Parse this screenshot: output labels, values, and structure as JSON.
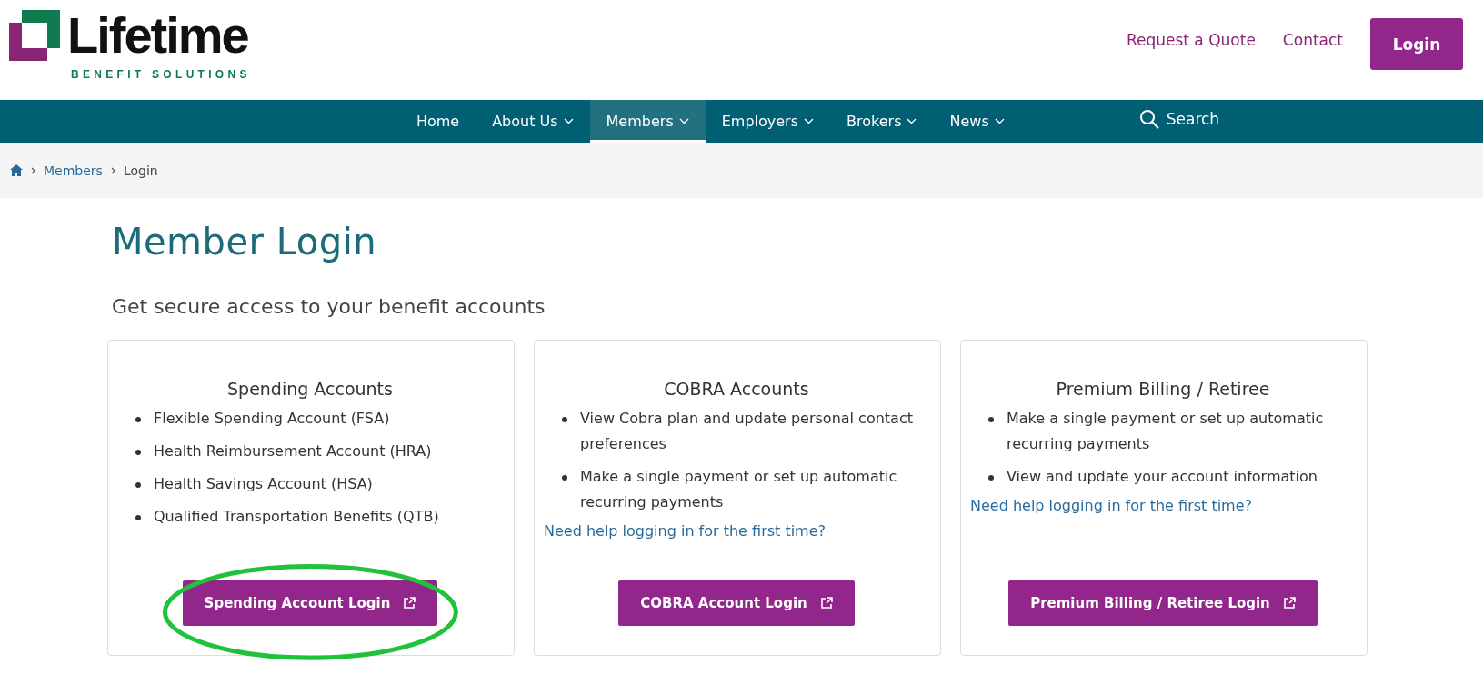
{
  "logo": {
    "name": "Lifetime",
    "tagline": "BENEFIT SOLUTIONS"
  },
  "header_links": [
    {
      "label": "Request a Quote"
    },
    {
      "label": "Contact"
    }
  ],
  "login_button": "Login",
  "nav": [
    {
      "label": "Home",
      "dropdown": false,
      "selected": false
    },
    {
      "label": "About Us",
      "dropdown": true,
      "selected": false
    },
    {
      "label": "Members",
      "dropdown": true,
      "selected": true
    },
    {
      "label": "Employers",
      "dropdown": true,
      "selected": false
    },
    {
      "label": "Brokers",
      "dropdown": true,
      "selected": false
    },
    {
      "label": "News",
      "dropdown": true,
      "selected": false
    }
  ],
  "search": "Search",
  "breadcrumb": [
    "Members",
    "Login"
  ],
  "title": "Member Login",
  "subtitle": "Get secure access to your benefit accounts",
  "cards": [
    {
      "title": "Spending Accounts",
      "items": [
        "Flexible Spending Account (FSA)",
        "Health Reimbursement Account (HRA)",
        "Health Savings Account (HSA)",
        "Qualified Transportation Benefits (QTB)"
      ],
      "button": "Spending Account Login",
      "highlighted": true
    },
    {
      "title": "COBRA Accounts",
      "items": [
        "View Cobra plan and update personal contact preferences",
        "Make a single payment or set up automatic recurring payments"
      ],
      "help_link": "Need help logging in for the first time?",
      "button": "COBRA Account Login",
      "highlighted": false
    },
    {
      "title": "Premium Billing / Retiree",
      "items": [
        "Make a single payment or set up automatic recurring payments",
        "View and update your account information"
      ],
      "help_link": "Need help logging in for the first time?",
      "button": "Premium Billing / Retiree Login",
      "highlighted": false
    }
  ]
}
